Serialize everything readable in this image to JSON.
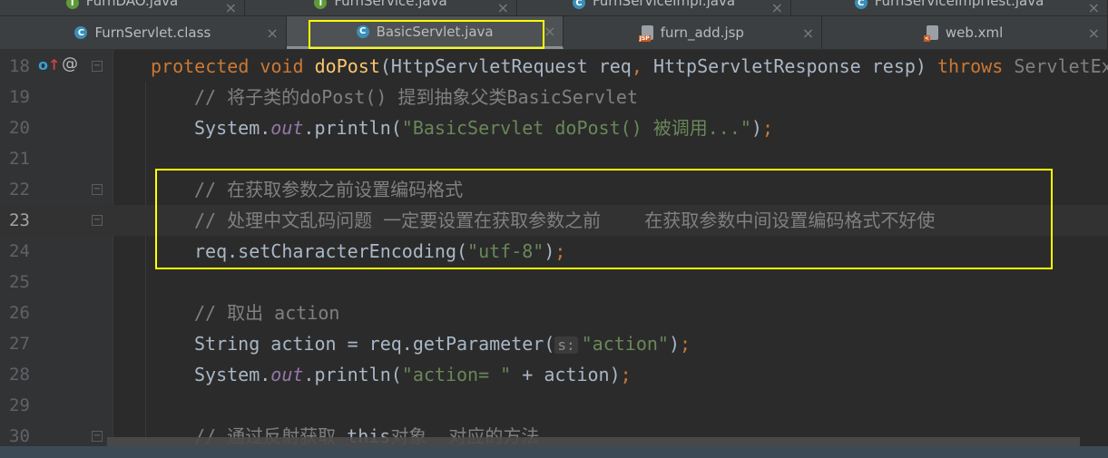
{
  "tabs_row1": [
    {
      "label": "FurnDAO.java",
      "icon": "interface-icon"
    },
    {
      "label": "FurnService.java",
      "icon": "interface-icon"
    },
    {
      "label": "FurnServiceImpl.java",
      "icon": "class-icon"
    },
    {
      "label": "FurnServiceImplTest.java",
      "icon": "class-icon"
    }
  ],
  "tabs_row2": [
    {
      "label": "FurnServlet.class",
      "icon": "class-icon"
    },
    {
      "label": "BasicServlet.java",
      "icon": "class-icon",
      "active": true
    },
    {
      "label": "furn_add.jsp",
      "icon": "jsp-file-icon"
    },
    {
      "label": "web.xml",
      "icon": "xml-file-icon"
    }
  ],
  "jsp_badge": "JSP",
  "close_glyph": "×",
  "inlay_hint": "s:",
  "highlight_color": "#ffff00",
  "gutter_marks": {
    "line": "18",
    "override_icon": "o↑",
    "annotation": "@"
  },
  "lines": [
    {
      "n": "18",
      "indent": 0,
      "tokens": [
        [
          "kw",
          "protected "
        ],
        [
          "kw",
          "void "
        ],
        [
          "fn",
          "doPost"
        ],
        [
          "ty",
          "(HttpServletRequest req"
        ],
        [
          "pn",
          ", "
        ],
        [
          "ty",
          "HttpServletResponse resp) "
        ],
        [
          "kw",
          "throws "
        ],
        [
          "dim",
          "ServletEx"
        ]
      ]
    },
    {
      "n": "19",
      "indent": 1,
      "tokens": [
        [
          "cm",
          "// 将子类的doPost() 提到抽象父类BasicServlet"
        ]
      ]
    },
    {
      "n": "20",
      "indent": 1,
      "tokens": [
        [
          "ty",
          "System."
        ],
        [
          "fld",
          "out"
        ],
        [
          "ty",
          ".println("
        ],
        [
          "str",
          "\"BasicServlet doPost() 被调用...\""
        ],
        [
          "ty",
          ")"
        ],
        [
          "pn",
          ";"
        ]
      ]
    },
    {
      "n": "21",
      "indent": 1,
      "tokens": []
    },
    {
      "n": "22",
      "indent": 1,
      "tokens": [
        [
          "cm",
          "// 在获取参数之前设置编码格式"
        ]
      ]
    },
    {
      "n": "23",
      "indent": 1,
      "current": true,
      "tokens": [
        [
          "cm",
          "// 处理中文乱码问题 一定要设置在获取参数之前    在获取参数中间设置编码格式不好使"
        ]
      ]
    },
    {
      "n": "24",
      "indent": 1,
      "tokens": [
        [
          "ty",
          "req.setCharacterEncoding("
        ],
        [
          "str",
          "\"utf-8\""
        ],
        [
          "ty",
          ")"
        ],
        [
          "pn",
          ";"
        ]
      ]
    },
    {
      "n": "25",
      "indent": 1,
      "tokens": []
    },
    {
      "n": "26",
      "indent": 1,
      "tokens": [
        [
          "cm",
          "// 取出 action"
        ]
      ]
    },
    {
      "n": "27",
      "indent": 1,
      "tokens": [
        [
          "ty",
          "String action = req.getParameter("
        ],
        [
          "hint",
          "s:"
        ],
        [
          "str",
          "\"action\""
        ],
        [
          "ty",
          ")"
        ],
        [
          "pn",
          ";"
        ]
      ]
    },
    {
      "n": "28",
      "indent": 1,
      "tokens": [
        [
          "ty",
          "System."
        ],
        [
          "fld",
          "out"
        ],
        [
          "ty",
          ".println("
        ],
        [
          "str",
          "\"action= \""
        ],
        [
          "ty",
          " + action)"
        ],
        [
          "pn",
          ";"
        ]
      ]
    },
    {
      "n": "29",
      "indent": 1,
      "tokens": []
    },
    {
      "n": "30",
      "indent": 1,
      "tokens": [
        [
          "cm",
          "// 通过反射获取 "
        ],
        [
          "ty",
          "this"
        ],
        [
          "cm",
          "对象  对应的方法"
        ]
      ]
    }
  ]
}
